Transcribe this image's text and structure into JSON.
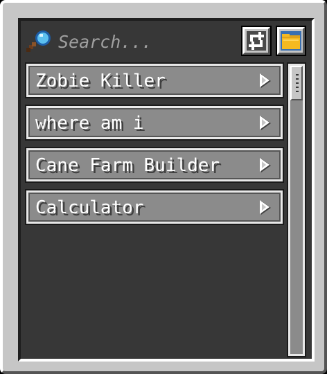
{
  "search": {
    "placeholder": "Search...",
    "icon": "magnifying-glass-icon"
  },
  "toolbar": {
    "refresh_icon": "refresh-icon",
    "folder_icon": "folder-icon"
  },
  "scripts": [
    {
      "label": "Zobie Killer"
    },
    {
      "label": "where am i"
    },
    {
      "label": "Cane Farm Builder"
    },
    {
      "label": "Calculator"
    }
  ],
  "colors": {
    "panel_bg": "#373737",
    "frame": "#c6c6c6",
    "item_bg": "#8b8b8b",
    "folder_yellow": "#f5b921"
  }
}
